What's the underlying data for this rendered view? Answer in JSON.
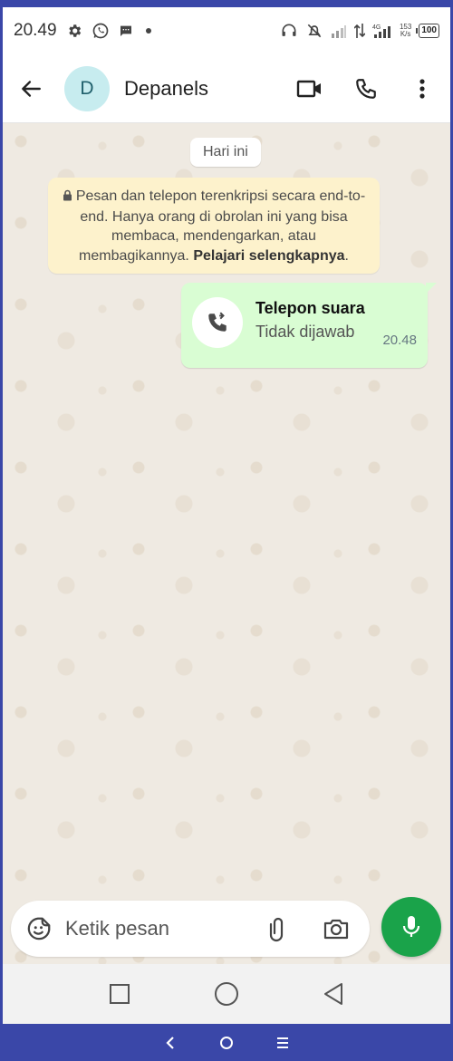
{
  "status_bar": {
    "time": "20.49",
    "network_speed_value": "153",
    "network_speed_unit": "K/s",
    "battery": "100",
    "icons": [
      "gear-icon",
      "whatsapp-icon",
      "message-icon",
      "dot-icon",
      "headset-icon",
      "mute-alarm-icon",
      "signal-icon",
      "data-arrows-icon",
      "4g-signal-icon",
      "battery-icon"
    ]
  },
  "header": {
    "avatar_letter": "D",
    "contact_name": "Depanels",
    "icons": [
      "back-arrow-icon",
      "video-call-icon",
      "phone-icon",
      "more-options-icon"
    ]
  },
  "chat": {
    "date_label": "Hari ini",
    "encryption_notice": {
      "text": "Pesan dan telepon terenkripsi secara end-to-end. Hanya orang di obrolan ini yang bisa membaca, mendengarkan, atau membagikannya.",
      "link": "Pelajari selengkapnya"
    },
    "call_message": {
      "title": "Telepon suara",
      "status": "Tidak dijawab",
      "time": "20.48"
    }
  },
  "composer": {
    "placeholder": "Ketik pesan",
    "icons": [
      "sticker-icon",
      "paperclip-icon",
      "camera-icon",
      "mic-icon"
    ]
  },
  "navigation": {
    "icons": [
      "recents-icon",
      "home-icon",
      "back-triangle-icon"
    ]
  },
  "outer_navigation": {
    "icons": [
      "chevron-left-icon",
      "circle-icon",
      "menu-icon"
    ]
  },
  "colors": {
    "accent_green": "#1aa34a",
    "bubble_green": "#d9fdd3",
    "notice_yellow": "#fdf2cc",
    "avatar_bg": "#c7ecef",
    "frame_blue": "#3a47a8"
  }
}
